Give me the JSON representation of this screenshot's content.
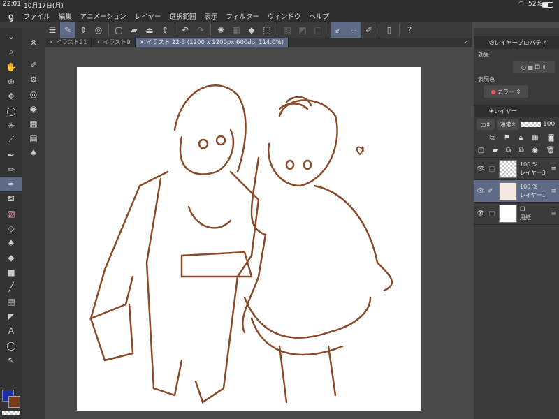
{
  "status": {
    "time": "22:01",
    "date": "10月17日(月)",
    "wifi": "wifi-icon",
    "battery": "52%"
  },
  "menu": [
    "ファイル",
    "編集",
    "アニメーション",
    "レイヤー",
    "選択範囲",
    "表示",
    "フィルター",
    "ウィンドウ",
    "ヘルプ"
  ],
  "tabs": [
    {
      "label": "イラスト21",
      "active": false
    },
    {
      "label": "イラスト9",
      "active": false
    },
    {
      "label": "イラスト 22-3 (1200 x 1200px 600dpi 114.0%)",
      "active": true
    }
  ],
  "right": {
    "layer_property": {
      "title": "レイヤープロパティ",
      "effect_label": "効果",
      "expression_label": "表現色",
      "expression_value": "カラー"
    },
    "layers_panel": {
      "title": "レイヤー",
      "blend_mode": "通常",
      "opacity": "100",
      "layers": [
        {
          "opacity": "100 %",
          "name": "レイヤー3",
          "selected": false
        },
        {
          "opacity": "100 %",
          "name": "レイヤー1",
          "selected": true
        },
        {
          "opacity": "",
          "name": "用紙",
          "selected": false
        }
      ]
    }
  },
  "colors": {
    "main": "#1d2ea0",
    "sub": "#7a3a17",
    "accent": "#5f6a86",
    "line": "#8a4a28"
  }
}
